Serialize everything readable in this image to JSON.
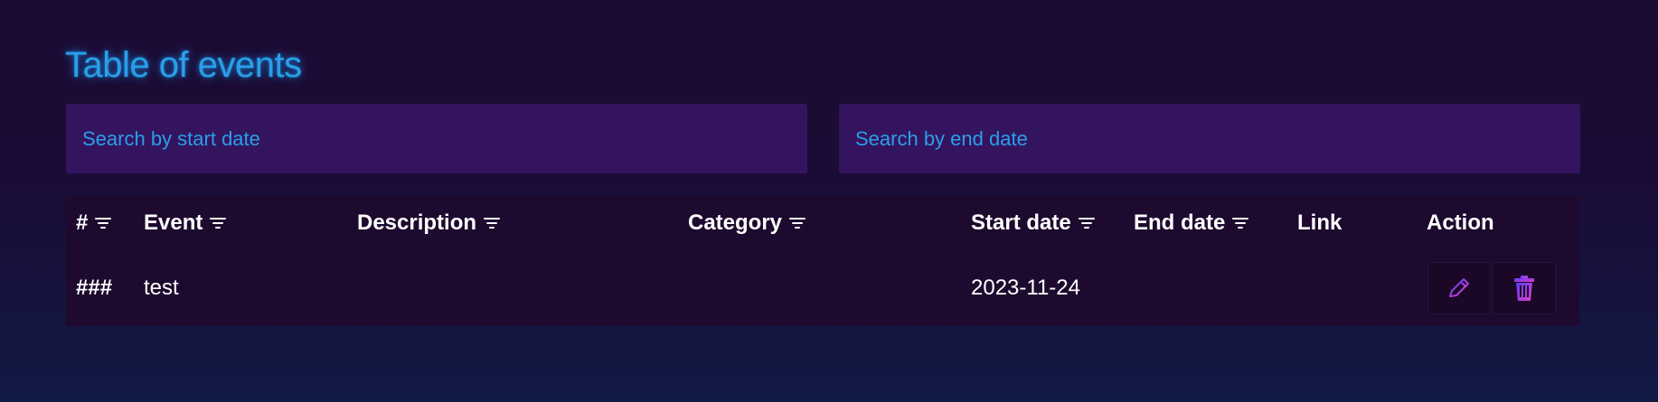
{
  "header": {
    "title": "Table of events"
  },
  "search": {
    "start_placeholder": "Search by start date",
    "end_placeholder": "Search by end date"
  },
  "table": {
    "columns": [
      {
        "label": "#",
        "sortable": true
      },
      {
        "label": "Event",
        "sortable": true
      },
      {
        "label": "Description",
        "sortable": true
      },
      {
        "label": "Category",
        "sortable": true
      },
      {
        "label": "Start date",
        "sortable": true
      },
      {
        "label": "End date",
        "sortable": true
      },
      {
        "label": "Link",
        "sortable": false
      },
      {
        "label": "Action",
        "sortable": false
      }
    ],
    "rows": [
      {
        "id": "###",
        "event": "test",
        "description": "",
        "category": "",
        "start_date": "2023-11-24",
        "end_date": "",
        "link": ""
      }
    ]
  },
  "icons": {
    "filter": "filter-icon",
    "edit": "pencil-icon",
    "delete": "trash-icon"
  },
  "colors": {
    "title": "#2a9fe8",
    "input_bg": "#34145f",
    "panel_bg": "#1e0a2e",
    "icon_gradient_start": "#5b3cf0",
    "icon_gradient_end": "#e23fd0"
  }
}
